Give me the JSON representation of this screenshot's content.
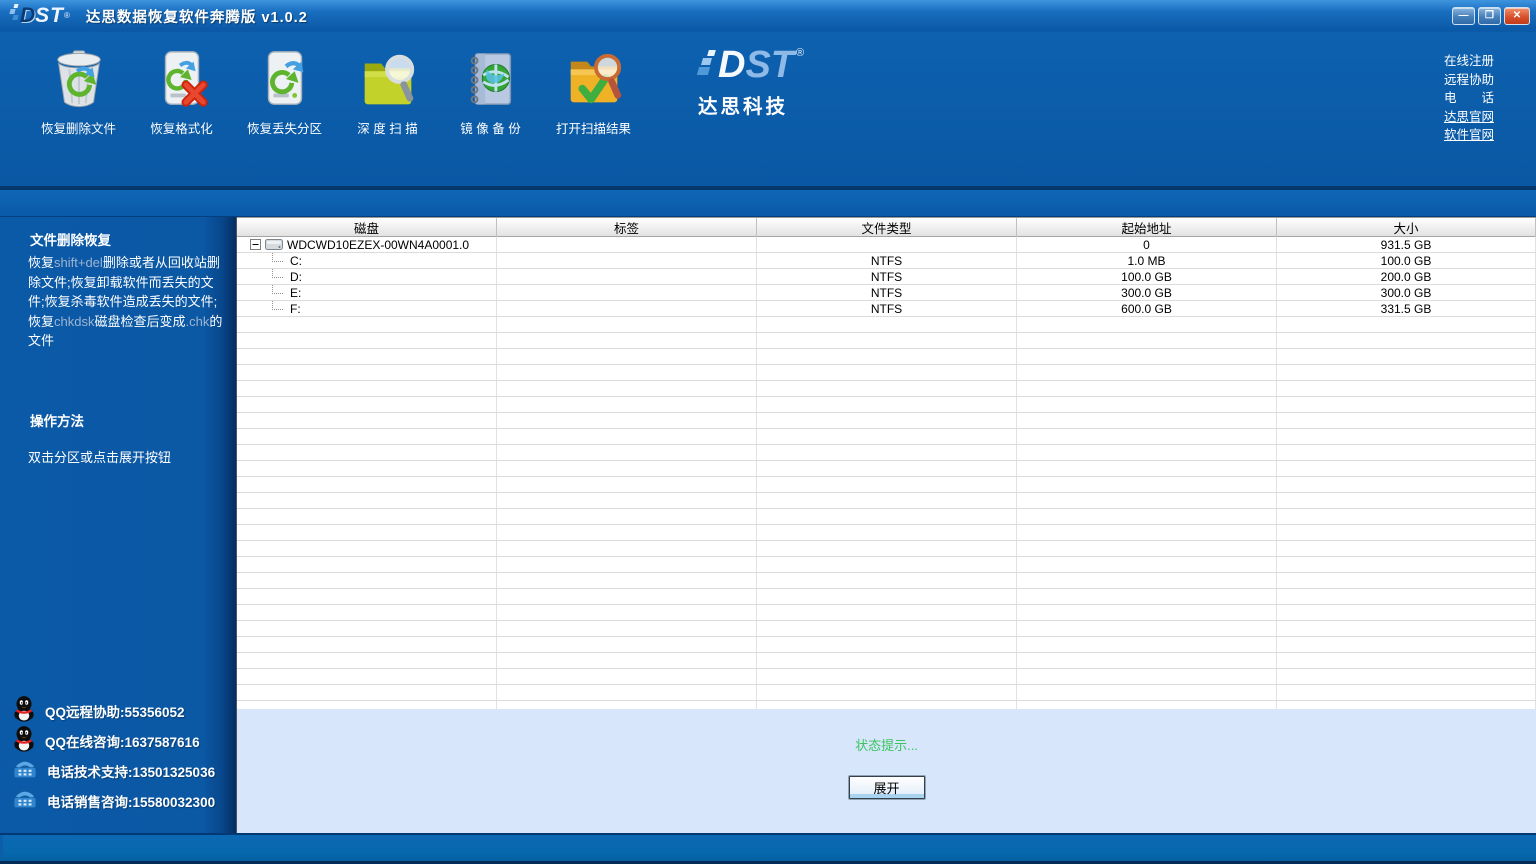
{
  "window": {
    "title": "达思数据恢复软件奔腾版 v1.0.2",
    "controls": [
      {
        "name": "minimize",
        "glyph": "—"
      },
      {
        "name": "maximize",
        "glyph": "❐"
      },
      {
        "name": "close",
        "glyph": "✕"
      }
    ]
  },
  "brand": {
    "d": "D",
    "st": "ST",
    "registered": "®",
    "company": "达思科技"
  },
  "toolbar": {
    "buttons": [
      {
        "name": "recover-deleted-files",
        "icon": "recycle-trash-icon",
        "label": "恢复删除文件"
      },
      {
        "name": "recover-formatted",
        "icon": "drive-format-icon",
        "label": "恢复格式化"
      },
      {
        "name": "recover-lost-partition",
        "icon": "drive-partition-icon",
        "label": "恢复丢失分区"
      },
      {
        "name": "deep-scan",
        "icon": "folder-scan-icon",
        "label": "深 度 扫 描"
      },
      {
        "name": "image-backup",
        "icon": "notebook-globe-icon",
        "label": "镜 像 备 份"
      },
      {
        "name": "open-scan-results",
        "icon": "folder-check-scan-icon",
        "label": "打开扫描结果"
      }
    ]
  },
  "quick_links": [
    {
      "name": "online-register",
      "label": "在线注册",
      "underline": false
    },
    {
      "name": "remote-assist",
      "label": "远程协助",
      "underline": false
    },
    {
      "name": "telephone",
      "label": "电　　话",
      "underline": false
    },
    {
      "name": "dasi-website",
      "label": "达思官网",
      "underline": true
    },
    {
      "name": "software-website",
      "label": "软件官网",
      "underline": true
    }
  ],
  "sidebar": {
    "section1_title": "文件删除恢复",
    "section1_body_segments": [
      {
        "text": "恢复",
        "muted": false
      },
      {
        "text": "shift+del",
        "muted": true
      },
      {
        "text": "删除或者从回收站删除文件;恢复卸载软件而丢失的文件;恢复杀毒软件造成丢失的文件;恢复",
        "muted": false
      },
      {
        "text": "chkdsk",
        "muted": true
      },
      {
        "text": "磁盘检查后变成",
        "muted": false
      },
      {
        "text": ".chk",
        "muted": true
      },
      {
        "text": "的文件",
        "muted": false
      }
    ],
    "section2_title": "操作方法",
    "section2_body": "双击分区或点击展开按钮",
    "contacts": [
      {
        "name": "qq-remote-assist",
        "icon": "qq-icon",
        "label": "QQ远程协助:55356052"
      },
      {
        "name": "qq-online-consult",
        "icon": "qq-icon",
        "label": "QQ在线咨询:1637587616"
      },
      {
        "name": "phone-tech-support",
        "icon": "phone-icon",
        "label": "电话技术支持:13501325036"
      },
      {
        "name": "phone-sales-consult",
        "icon": "phone-icon",
        "label": "电话销售咨询:15580032300"
      }
    ]
  },
  "table": {
    "columns": [
      "磁盘",
      "标签",
      "文件类型",
      "起始地址",
      "大小"
    ],
    "rows": [
      {
        "level": 0,
        "expand": "-",
        "name": "WDCWD10EZEX-00WN4A0001.0",
        "label": "",
        "fs": "",
        "start": "0",
        "size": "931.5 GB"
      },
      {
        "level": 1,
        "name": "C:",
        "label": "",
        "fs": "NTFS",
        "start": "1.0 MB",
        "size": "100.0 GB"
      },
      {
        "level": 1,
        "name": "D:",
        "label": "",
        "fs": "NTFS",
        "start": "100.0 GB",
        "size": "200.0 GB"
      },
      {
        "level": 1,
        "name": "E:",
        "label": "",
        "fs": "NTFS",
        "start": "300.0 GB",
        "size": "300.0 GB"
      },
      {
        "level": 1,
        "name": "F:",
        "label": "",
        "fs": "NTFS",
        "start": "600.0 GB",
        "size": "331.5 GB"
      }
    ],
    "empty_row_count": 25
  },
  "status": {
    "message": "状态提示...",
    "expand_button": "展开"
  },
  "colors": {
    "base_blue": "#0a58a4",
    "panel_light": "#d7e6fb",
    "status_green": "#3cc45e"
  }
}
